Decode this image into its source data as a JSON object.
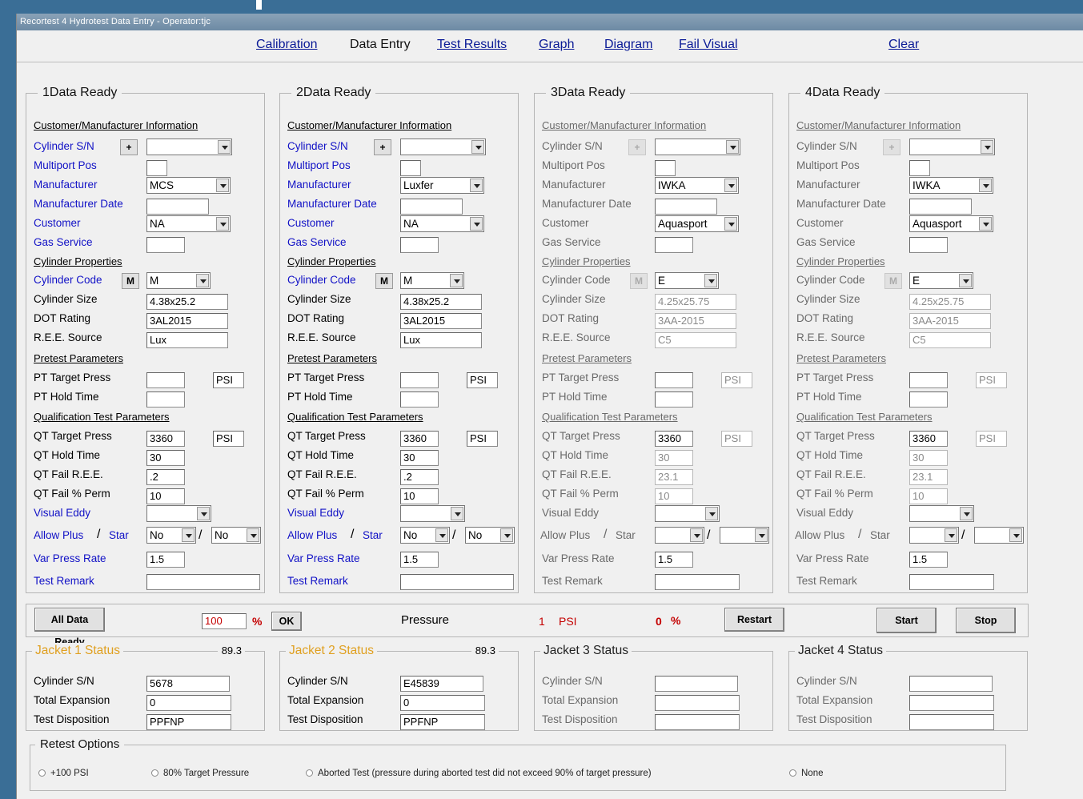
{
  "window": {
    "title": "Recortest 4 Hydrotest Data Entry - Operator:tjc"
  },
  "nav": {
    "calibration": "Calibration",
    "data_entry": "Data Entry",
    "test_results": "Test Results",
    "graph": "Graph",
    "diagram": "Diagram",
    "fail_visual": "Fail Visual",
    "clear": "Clear"
  },
  "labels": {
    "cust_mfr_info": "Customer/Manufacturer Information",
    "cylinder_sn": "Cylinder S/N",
    "multiport_pos": "Multiport Pos",
    "manufacturer": "Manufacturer",
    "manufacturer_date": "Manufacturer Date",
    "customer": "Customer",
    "gas_service": "Gas Service",
    "cylinder_properties": "Cylinder Properties",
    "cylinder_code": "Cylinder Code",
    "cylinder_size": "Cylinder Size",
    "dot_rating": "DOT Rating",
    "ree_source": "R.E.E. Source",
    "pretest_parameters": "Pretest Parameters",
    "pt_target_press": "PT Target Press",
    "pt_hold_time": "PT Hold Time",
    "qual_test_params": "Qualification Test Parameters",
    "qt_target_press": "QT Target Press",
    "qt_hold_time": "QT Hold Time",
    "qt_fail_ree": "QT Fail R.E.E.",
    "qt_fail_perm": "QT Fail % Perm",
    "visual_eddy": "Visual Eddy",
    "allow_plus": "Allow Plus",
    "slash": "/",
    "star": "Star",
    "var_press_rate": "Var Press Rate",
    "test_remark": "Test Remark",
    "plus_btn": "+",
    "m_btn": "M",
    "jacket_cyl_sn": "Cylinder S/N",
    "total_expansion": "Total Expansion",
    "test_disposition": "Test Disposition"
  },
  "panels": [
    {
      "title": "1Data Ready",
      "cylinder_sn": "",
      "multiport_pos": "",
      "manufacturer": "MCS",
      "manufacturer_date": "",
      "customer": "NA",
      "gas_service": "",
      "cylinder_code": "M",
      "cylinder_size": "4.38x25.2",
      "dot_rating": "3AL2015",
      "ree_source": "Lux",
      "pt_target_press": "",
      "pt_unit": "PSI",
      "pt_hold_time": "",
      "qt_target_press": "3360",
      "qt_unit": "PSI",
      "qt_hold_time": "30",
      "qt_fail_ree": ".2",
      "qt_fail_perm": "10",
      "visual_eddy": "",
      "allow_plus": "No",
      "star": "No",
      "var_press_rate": "1.5",
      "test_remark": ""
    },
    {
      "title": "2Data Ready",
      "cylinder_sn": "",
      "multiport_pos": "",
      "manufacturer": "Luxfer",
      "manufacturer_date": "",
      "customer": "NA",
      "gas_service": "",
      "cylinder_code": "M",
      "cylinder_size": "4.38x25.2",
      "dot_rating": "3AL2015",
      "ree_source": "Lux",
      "pt_target_press": "",
      "pt_unit": "PSI",
      "pt_hold_time": "",
      "qt_target_press": "3360",
      "qt_unit": "PSI",
      "qt_hold_time": "30",
      "qt_fail_ree": ".2",
      "qt_fail_perm": "10",
      "visual_eddy": "",
      "allow_plus": "No",
      "star": "No",
      "var_press_rate": "1.5",
      "test_remark": ""
    },
    {
      "title": "3Data Ready",
      "cylinder_sn": "",
      "multiport_pos": "",
      "manufacturer": "IWKA",
      "manufacturer_date": "",
      "customer": "Aquasport",
      "gas_service": "",
      "cylinder_code": "E",
      "cylinder_size": "4.25x25.75",
      "dot_rating": "3AA-2015",
      "ree_source": "C5",
      "pt_target_press": "",
      "pt_unit": "PSI",
      "pt_hold_time": "",
      "qt_target_press": "3360",
      "qt_unit": "PSI",
      "qt_hold_time": "30",
      "qt_fail_ree": "23.1",
      "qt_fail_perm": "10",
      "visual_eddy": "",
      "allow_plus": "",
      "star": "",
      "var_press_rate": "1.5",
      "test_remark": ""
    },
    {
      "title": "4Data Ready",
      "cylinder_sn": "",
      "multiport_pos": "",
      "manufacturer": "IWKA",
      "manufacturer_date": "",
      "customer": "Aquasport",
      "gas_service": "",
      "cylinder_code": "E",
      "cylinder_size": "4.25x25.75",
      "dot_rating": "3AA-2015",
      "ree_source": "C5",
      "pt_target_press": "",
      "pt_unit": "PSI",
      "pt_hold_time": "",
      "qt_target_press": "3360",
      "qt_unit": "PSI",
      "qt_hold_time": "30",
      "qt_fail_ree": "23.1",
      "qt_fail_perm": "10",
      "visual_eddy": "",
      "allow_plus": "",
      "star": "",
      "var_press_rate": "1.5",
      "test_remark": ""
    }
  ],
  "controls": {
    "all_data_ready": "All Data Ready",
    "percent_value": "100",
    "percent_sign": "%",
    "ok": "OK",
    "pressure_label": "Pressure",
    "pressure_value": "1",
    "pressure_unit": "PSI",
    "pct_value": "0",
    "pct_sign": "%",
    "restart": "Restart",
    "start": "Start",
    "stop": "Stop"
  },
  "jackets": [
    {
      "title": "Jacket 1 Status",
      "reading": "89.3",
      "cylinder_sn": "5678",
      "total_expansion": "0",
      "test_disposition": "PPFNP"
    },
    {
      "title": "Jacket 2 Status",
      "reading": "89.3",
      "cylinder_sn": "E45839",
      "total_expansion": "0",
      "test_disposition": "PPFNP"
    },
    {
      "title": "Jacket 3 Status",
      "reading": "",
      "cylinder_sn": "",
      "total_expansion": "",
      "test_disposition": ""
    },
    {
      "title": "Jacket 4 Status",
      "reading": "",
      "cylinder_sn": "",
      "total_expansion": "",
      "test_disposition": ""
    }
  ],
  "retest": {
    "title": "Retest Options",
    "opt1": "+100 PSI",
    "opt2": "80% Target Pressure",
    "opt3": "Aborted Test (pressure during aborted test did not exceed 90% of target pressure)",
    "opt4": "None"
  },
  "colors": {
    "label_blue": "#1111c6",
    "jacket_active": "#e0a020",
    "alert_red": "#c40000"
  }
}
